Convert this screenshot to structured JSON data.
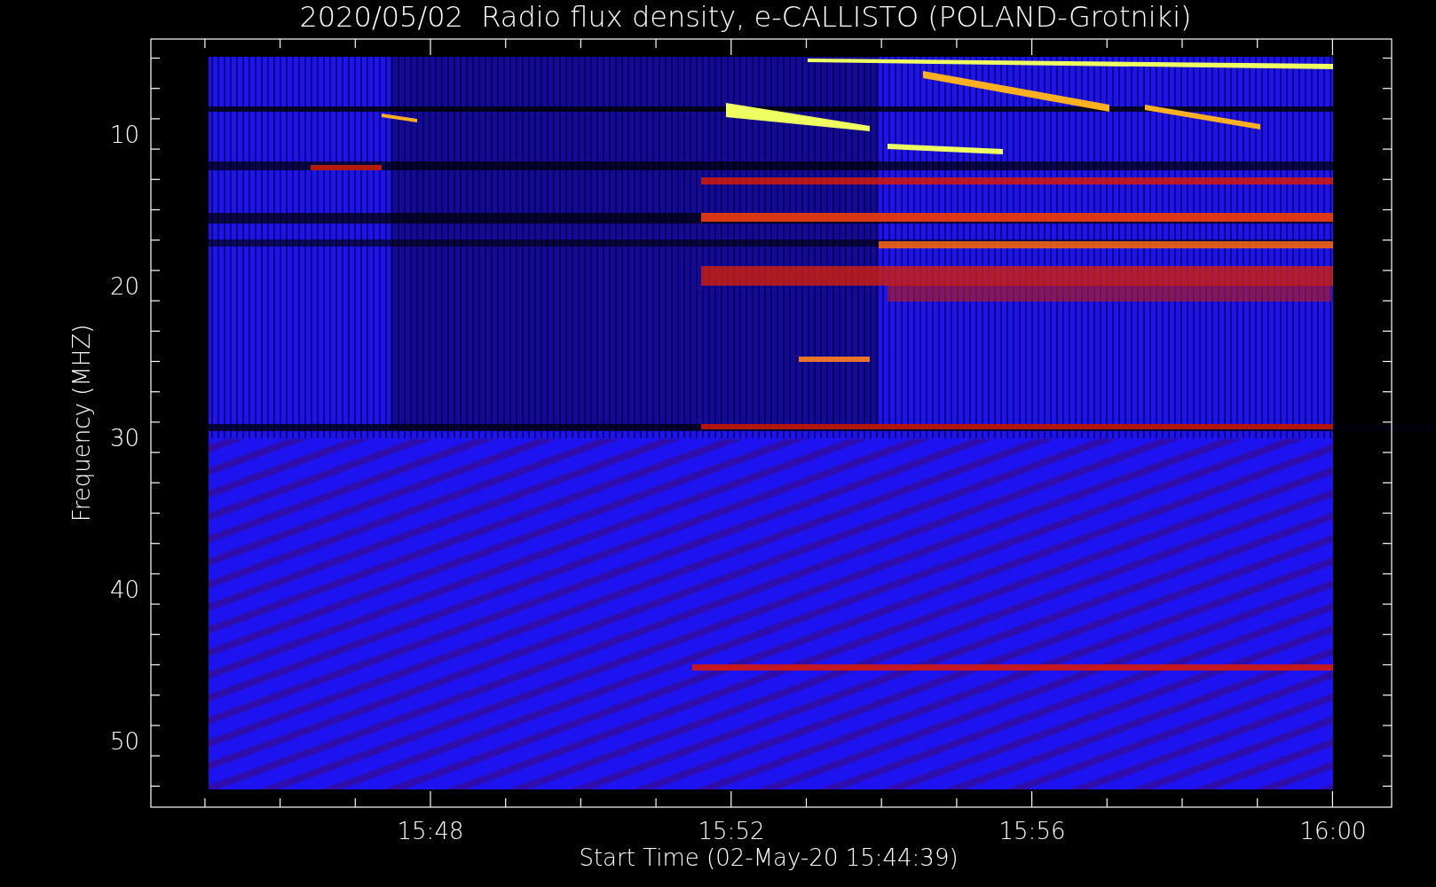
{
  "title": "2020/05/02  Radio flux density, e-CALLISTO (POLAND-Grotniki)",
  "y_axis": {
    "label": "Frequency (MHZ)",
    "ticks": [
      "10",
      "20",
      "30",
      "40",
      "50"
    ]
  },
  "x_axis": {
    "label": "Start Time (02-May-20 15:44:39)",
    "ticks": [
      "15:48",
      "15:52",
      "15:56",
      "16:00"
    ]
  }
}
